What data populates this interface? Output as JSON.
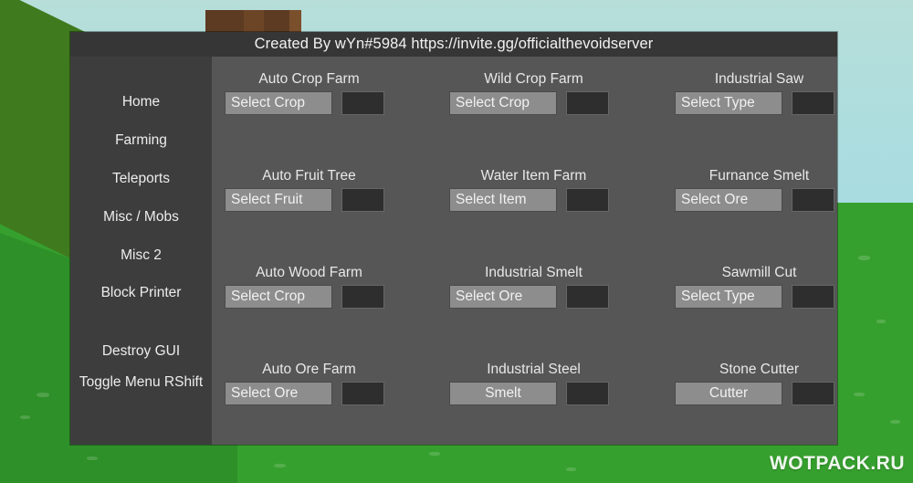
{
  "window": {
    "titlebar_text": "Created By wYn#5984  https://invite.gg/officialthevoidserver",
    "colors": {
      "titlebar_bg": "#363636",
      "sidebar_bg": "#3d3d3d",
      "content_bg": "#565656",
      "dropdown_bg": "#8d8d8d",
      "toggle_bg": "#2e2e2e",
      "text": "#ededed"
    }
  },
  "sidebar": {
    "items": [
      {
        "label": "Home"
      },
      {
        "label": "Farming"
      },
      {
        "label": "Teleports"
      },
      {
        "label": "Misc / Mobs"
      },
      {
        "label": "Misc 2"
      },
      {
        "label": "Block Printer"
      },
      {
        "label": "Destroy GUI"
      },
      {
        "label": "Toggle Menu\nRShift"
      }
    ]
  },
  "main": {
    "cells": [
      {
        "title": "Auto Crop Farm",
        "button": "Select Crop",
        "button_align": "left",
        "toggle": "off"
      },
      {
        "title": "Wild Crop Farm",
        "button": "Select Crop",
        "button_align": "left",
        "toggle": "off"
      },
      {
        "title": "Industrial Saw",
        "button": "Select Type",
        "button_align": "left",
        "toggle": "off"
      },
      {
        "title": "Auto Fruit Tree",
        "button": "Select Fruit",
        "button_align": "left",
        "toggle": "off"
      },
      {
        "title": "Water Item Farm",
        "button": "Select Item",
        "button_align": "left",
        "toggle": "off"
      },
      {
        "title": "Furnance Smelt",
        "button": "Select Ore",
        "button_align": "left",
        "toggle": "off"
      },
      {
        "title": "Auto Wood Farm",
        "button": "Select Crop",
        "button_align": "left",
        "toggle": "off"
      },
      {
        "title": "Industrial Smelt",
        "button": "Select Ore",
        "button_align": "left",
        "toggle": "off"
      },
      {
        "title": "Sawmill Cut",
        "button": "Select Type",
        "button_align": "left",
        "toggle": "off"
      },
      {
        "title": "Auto Ore Farm",
        "button": "Select Ore",
        "button_align": "left",
        "toggle": "off"
      },
      {
        "title": "Industrial Steel",
        "button": "Smelt",
        "button_align": "center",
        "toggle": "off"
      },
      {
        "title": "Stone Cutter",
        "button": "Cutter",
        "button_align": "center",
        "toggle": "off"
      }
    ]
  },
  "watermark": {
    "text": "WOTPACK.RU"
  },
  "background": {
    "sky_color": "#a7dce2",
    "grass_color": "#36a02e",
    "grass_dark_color": "#3f7a1f",
    "wood_color": "#5c3b22"
  }
}
